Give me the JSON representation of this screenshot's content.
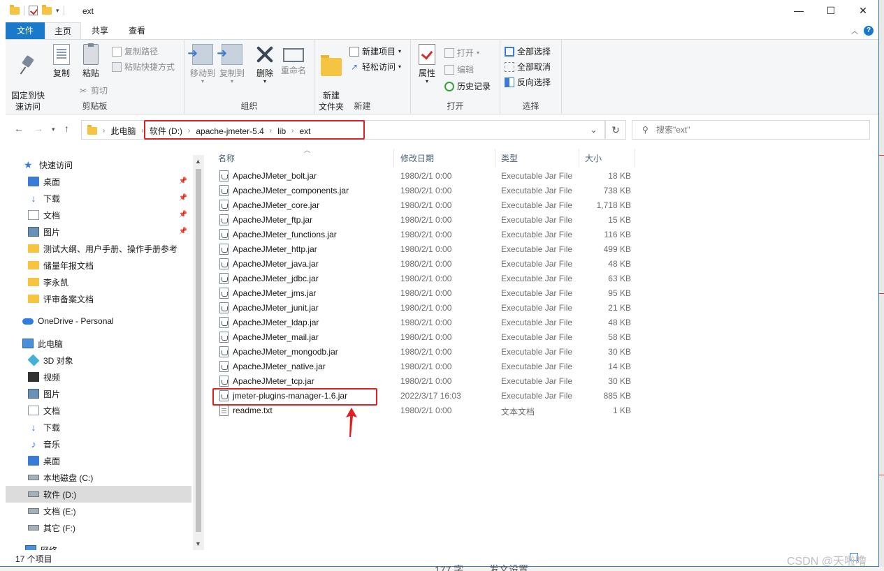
{
  "window": {
    "title": "ext",
    "controls": {
      "minimize": "—",
      "maximize": "☐",
      "close": "✕"
    }
  },
  "ribbon_tabs": [
    "文件",
    "主页",
    "共享",
    "查看"
  ],
  "ribbon": {
    "clipboard": {
      "label": "剪贴板",
      "pin_quick": "固定到快\n速访问",
      "copy": "复制",
      "paste": "粘贴",
      "copy_path": "复制路径",
      "paste_shortcut": "粘贴快捷方式",
      "cut": "剪切"
    },
    "organize": {
      "label": "组织",
      "move_to": "移动到",
      "copy_to": "复制到",
      "delete": "删除",
      "rename": "重命名"
    },
    "new": {
      "label": "新建",
      "new_folder": "新建\n文件夹",
      "new_item": "新建项目",
      "easy_access": "轻松访问"
    },
    "open": {
      "label": "打开",
      "properties": "属性",
      "open": "打开",
      "edit": "编辑",
      "history": "历史记录"
    },
    "select": {
      "label": "选择",
      "select_all": "全部选择",
      "select_none": "全部取消",
      "invert": "反向选择"
    }
  },
  "address": {
    "root": "此电脑",
    "crumbs": [
      "软件 (D:)",
      "apache-jmeter-5.4",
      "lib",
      "ext"
    ]
  },
  "search": {
    "placeholder": "搜索\"ext\""
  },
  "sidebar": {
    "quick_access": "快速访问",
    "quick_items": [
      {
        "label": "桌面",
        "icon": "desktop-icon",
        "pinned": true
      },
      {
        "label": "下载",
        "icon": "download-icon",
        "pinned": true
      },
      {
        "label": "文档",
        "icon": "documents-icon",
        "pinned": true
      },
      {
        "label": "图片",
        "icon": "pictures-icon",
        "pinned": true
      },
      {
        "label": "测试大纲、用户手册、操作手册参考",
        "icon": "folder-icon",
        "pinned": false
      },
      {
        "label": "储量年报文档",
        "icon": "folder-icon",
        "pinned": false
      },
      {
        "label": "李永凯",
        "icon": "folder-icon",
        "pinned": false
      },
      {
        "label": "评审备案文档",
        "icon": "folder-icon",
        "pinned": false
      }
    ],
    "onedrive": "OneDrive - Personal",
    "this_pc": "此电脑",
    "pc_items": [
      {
        "label": "3D 对象",
        "icon": "3d-objects-icon"
      },
      {
        "label": "视频",
        "icon": "videos-icon"
      },
      {
        "label": "图片",
        "icon": "pictures-icon"
      },
      {
        "label": "文档",
        "icon": "documents-icon"
      },
      {
        "label": "下载",
        "icon": "download-icon"
      },
      {
        "label": "音乐",
        "icon": "music-icon"
      },
      {
        "label": "桌面",
        "icon": "desktop-icon"
      },
      {
        "label": "本地磁盘 (C:)",
        "icon": "drive-icon"
      },
      {
        "label": "软件 (D:)",
        "icon": "drive-icon",
        "selected": true
      },
      {
        "label": "文档 (E:)",
        "icon": "drive-icon"
      },
      {
        "label": "其它 (F:)",
        "icon": "drive-icon"
      }
    ],
    "network": "网络"
  },
  "columns": {
    "name": "名称",
    "date": "修改日期",
    "type": "类型",
    "size": "大小"
  },
  "files": [
    {
      "name": "ApacheJMeter_bolt.jar",
      "date": "1980/2/1 0:00",
      "type": "Executable Jar File",
      "size": "18 KB",
      "kind": "jar"
    },
    {
      "name": "ApacheJMeter_components.jar",
      "date": "1980/2/1 0:00",
      "type": "Executable Jar File",
      "size": "738 KB",
      "kind": "jar"
    },
    {
      "name": "ApacheJMeter_core.jar",
      "date": "1980/2/1 0:00",
      "type": "Executable Jar File",
      "size": "1,718 KB",
      "kind": "jar"
    },
    {
      "name": "ApacheJMeter_ftp.jar",
      "date": "1980/2/1 0:00",
      "type": "Executable Jar File",
      "size": "15 KB",
      "kind": "jar"
    },
    {
      "name": "ApacheJMeter_functions.jar",
      "date": "1980/2/1 0:00",
      "type": "Executable Jar File",
      "size": "116 KB",
      "kind": "jar"
    },
    {
      "name": "ApacheJMeter_http.jar",
      "date": "1980/2/1 0:00",
      "type": "Executable Jar File",
      "size": "499 KB",
      "kind": "jar"
    },
    {
      "name": "ApacheJMeter_java.jar",
      "date": "1980/2/1 0:00",
      "type": "Executable Jar File",
      "size": "48 KB",
      "kind": "jar"
    },
    {
      "name": "ApacheJMeter_jdbc.jar",
      "date": "1980/2/1 0:00",
      "type": "Executable Jar File",
      "size": "63 KB",
      "kind": "jar"
    },
    {
      "name": "ApacheJMeter_jms.jar",
      "date": "1980/2/1 0:00",
      "type": "Executable Jar File",
      "size": "95 KB",
      "kind": "jar"
    },
    {
      "name": "ApacheJMeter_junit.jar",
      "date": "1980/2/1 0:00",
      "type": "Executable Jar File",
      "size": "21 KB",
      "kind": "jar"
    },
    {
      "name": "ApacheJMeter_ldap.jar",
      "date": "1980/2/1 0:00",
      "type": "Executable Jar File",
      "size": "48 KB",
      "kind": "jar"
    },
    {
      "name": "ApacheJMeter_mail.jar",
      "date": "1980/2/1 0:00",
      "type": "Executable Jar File",
      "size": "58 KB",
      "kind": "jar"
    },
    {
      "name": "ApacheJMeter_mongodb.jar",
      "date": "1980/2/1 0:00",
      "type": "Executable Jar File",
      "size": "30 KB",
      "kind": "jar"
    },
    {
      "name": "ApacheJMeter_native.jar",
      "date": "1980/2/1 0:00",
      "type": "Executable Jar File",
      "size": "14 KB",
      "kind": "jar"
    },
    {
      "name": "ApacheJMeter_tcp.jar",
      "date": "1980/2/1 0:00",
      "type": "Executable Jar File",
      "size": "30 KB",
      "kind": "jar"
    },
    {
      "name": "jmeter-plugins-manager-1.6.jar",
      "date": "2022/3/17 16:03",
      "type": "Executable Jar File",
      "size": "885 KB",
      "kind": "jar",
      "highlighted": true
    },
    {
      "name": "readme.txt",
      "date": "1980/2/1 0:00",
      "type": "文本文档",
      "size": "1 KB",
      "kind": "txt"
    }
  ],
  "status": {
    "count": "17 个项目"
  },
  "watermark": "CSDN @天啦噜",
  "background_text": {
    "left": "177 字",
    "right": "发文设置"
  },
  "colors": {
    "accent": "#1979ca",
    "highlight": "#e02020",
    "folder": "#f5c542"
  }
}
